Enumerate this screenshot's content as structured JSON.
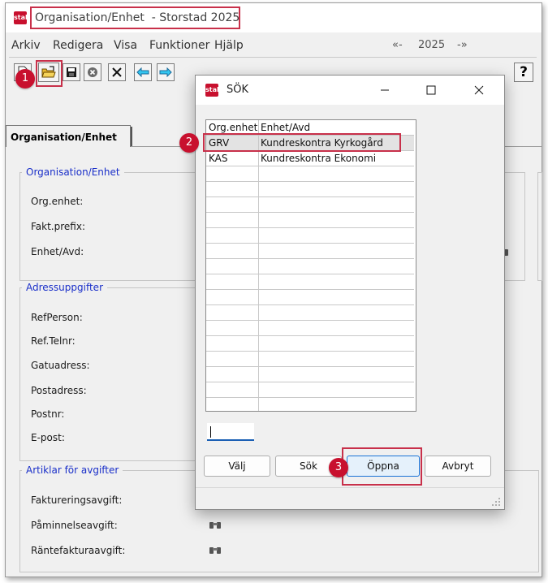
{
  "main_window": {
    "title": "Organisation/Enhet  - Storstad 2025",
    "logo_text": "stal",
    "menu": [
      "Arkiv",
      "Redigera",
      "Visa",
      "Funktioner",
      "Hjälp"
    ],
    "nav": {
      "prev": "«-",
      "year": "2025",
      "next": "-»"
    },
    "help_label": "?",
    "tab_label": "Organisation/Enhet",
    "groups": {
      "org": {
        "title": "Organisation/Enhet",
        "fields": [
          "Org.enhet:",
          "Fakt.prefix:",
          "Enhet/Avd:"
        ]
      },
      "address": {
        "title": "Adressuppgifter",
        "fields": [
          "RefPerson:",
          "Ref.Telnr:",
          "Gatuadress:",
          "Postadress:",
          "Postnr:",
          "E-post:"
        ]
      },
      "articles": {
        "title": "Artiklar för avgifter",
        "fields": [
          "Faktureringsavgift:",
          "Påminnelseavgift:",
          "Räntefakturaavgift:"
        ]
      }
    }
  },
  "dialog": {
    "title": "SÖK",
    "columns": [
      "Org.enhet",
      "Enhet/Avd"
    ],
    "rows": [
      [
        "GRV",
        "Kundreskontra Kyrkogård"
      ],
      [
        "KAS",
        "Kundreskontra Ekonomi"
      ]
    ],
    "search_value": "",
    "buttons": {
      "select": "Välj",
      "search": "Sök",
      "open": "Öppna",
      "cancel": "Avbryt"
    }
  },
  "steps": [
    "1",
    "2",
    "3"
  ],
  "colors": {
    "accent_red": "#c8102e",
    "highlight_border": "#c8304a",
    "group_title": "#1a2fc9"
  }
}
